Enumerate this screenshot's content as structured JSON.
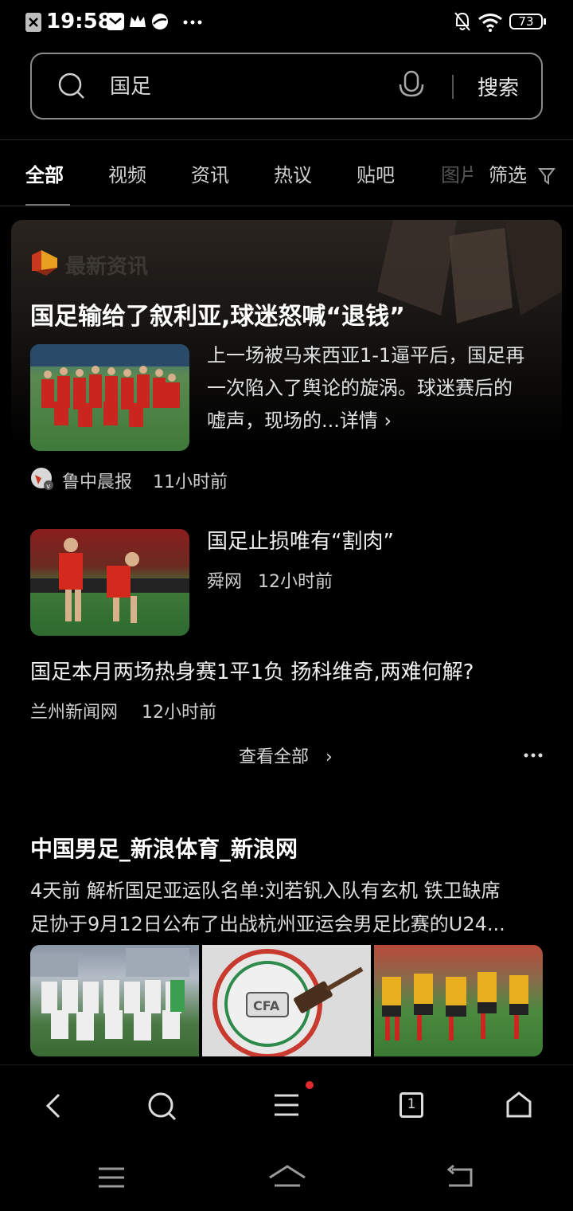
{
  "status_bar": {
    "time": "19:58",
    "battery": "73"
  },
  "search": {
    "query": "国足",
    "button_label": "搜索"
  },
  "tabs": [
    {
      "label": "全部",
      "active": true
    },
    {
      "label": "视频"
    },
    {
      "label": "资讯"
    },
    {
      "label": "热议"
    },
    {
      "label": "贴吧"
    },
    {
      "label": "图片"
    }
  ],
  "filter_label": "筛选",
  "news_card": {
    "label": "最新资讯",
    "headline": "国足输给了叙利亚,球迷怒喊“退钱”",
    "item1": {
      "summary_line1": "上一场被马来西亚1-1逼平后，国足再",
      "summary_line2": "一次陷入了舆论的旋涡。球迷赛后的",
      "summary_line3": "嘘声，现场的...详情 ›",
      "source": "鲁中晨报",
      "time": "11小时前"
    },
    "item2": {
      "title": "国足止损唯有“割肉”",
      "source": "舜网",
      "time": "12小时前"
    },
    "item3": {
      "title": "国足本月两场热身赛1平1负 扬科维奇,两难何解?",
      "source": "兰州新闻网",
      "time": "12小时前"
    },
    "more_label": "查看全部"
  },
  "result2": {
    "title": "中国男足_新浪体育_新浪网",
    "line1": "4天前  解析国足亚运队名单:刘若钒入队有玄机 铁卫缺席",
    "line2": "足协于9月12日公布了出战杭州亚运会男足比赛的U24..."
  },
  "browser_bar": {
    "tab_count": "1"
  }
}
